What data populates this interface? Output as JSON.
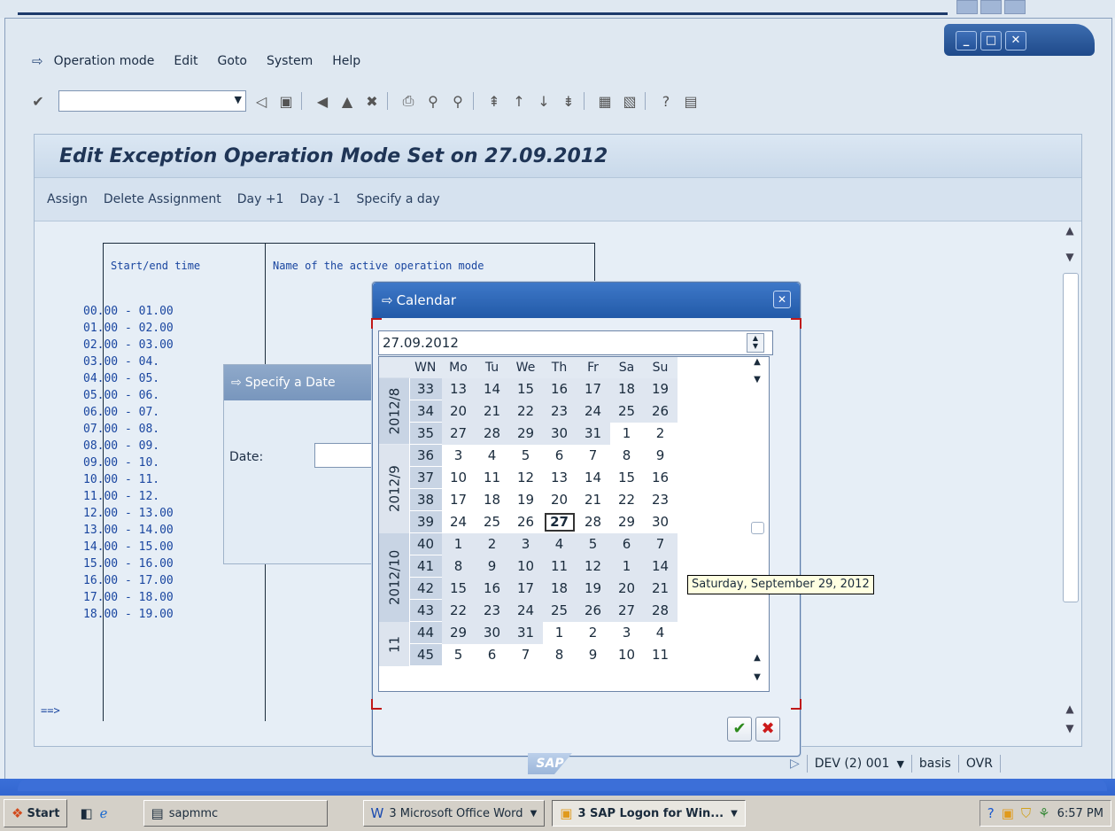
{
  "menu": {
    "items": [
      "Operation mode",
      "Edit",
      "Goto",
      "System",
      "Help"
    ]
  },
  "toolbar": {
    "command_value": ""
  },
  "page": {
    "title": "Edit Exception Operation Mode Set on 27.09.2012",
    "app_buttons": [
      "Assign",
      "Delete Assignment",
      "Day +1",
      "Day -1",
      "Specify a day"
    ]
  },
  "table": {
    "col1": "Start/end time",
    "col2": "Name of the active operation mode",
    "rows": [
      "00.00 - 01.00",
      "01.00 - 02.00",
      "02.00 - 03.00",
      "03.00 - 04.",
      "04.00 - 05.",
      "05.00 - 06.",
      "06.00 - 07.",
      "07.00 - 08.",
      "08.00 - 09.",
      "09.00 - 10.",
      "10.00 - 11.",
      "11.00 - 12.",
      "12.00 - 13.00",
      "13.00 - 14.00",
      "14.00 - 15.00",
      "15.00 - 16.00",
      "16.00 - 17.00",
      "17.00 - 18.00",
      "18.00 - 19.00"
    ],
    "current_marker": "==>"
  },
  "specify_dialog": {
    "title": "Specify a Date",
    "date_label": "Date:"
  },
  "calendar": {
    "title": "Calendar",
    "date_value": "27.09.2012",
    "headers": [
      "WN",
      "Mo",
      "Tu",
      "We",
      "Th",
      "Fr",
      "Sa",
      "Su"
    ],
    "month_labels": [
      "2012/8",
      "2012/9",
      "2012/10",
      "11"
    ],
    "weeks": [
      {
        "wn": "33",
        "days": [
          "13",
          "14",
          "15",
          "16",
          "17",
          "18",
          "19"
        ]
      },
      {
        "wn": "34",
        "days": [
          "20",
          "21",
          "22",
          "23",
          "24",
          "25",
          "26"
        ]
      },
      {
        "wn": "35",
        "days": [
          "27",
          "28",
          "29",
          "30",
          "31",
          "1",
          "2"
        ]
      },
      {
        "wn": "36",
        "days": [
          "3",
          "4",
          "5",
          "6",
          "7",
          "8",
          "9"
        ]
      },
      {
        "wn": "37",
        "days": [
          "10",
          "11",
          "12",
          "13",
          "14",
          "15",
          "16"
        ]
      },
      {
        "wn": "38",
        "days": [
          "17",
          "18",
          "19",
          "20",
          "21",
          "22",
          "23"
        ]
      },
      {
        "wn": "39",
        "days": [
          "24",
          "25",
          "26",
          "27",
          "28",
          "29",
          "30"
        ]
      },
      {
        "wn": "40",
        "days": [
          "1",
          "2",
          "3",
          "4",
          "5",
          "6",
          "7"
        ]
      },
      {
        "wn": "41",
        "days": [
          "8",
          "9",
          "10",
          "11",
          "12",
          "1",
          "14"
        ]
      },
      {
        "wn": "42",
        "days": [
          "15",
          "16",
          "17",
          "18",
          "19",
          "20",
          "21"
        ]
      },
      {
        "wn": "43",
        "days": [
          "22",
          "23",
          "24",
          "25",
          "26",
          "27",
          "28"
        ]
      },
      {
        "wn": "44",
        "days": [
          "29",
          "30",
          "31",
          "1",
          "2",
          "3",
          "4"
        ]
      },
      {
        "wn": "45",
        "days": [
          "5",
          "6",
          "7",
          "8",
          "9",
          "10",
          "11"
        ]
      }
    ],
    "tooltip": "Saturday, September 29, 2012"
  },
  "status": {
    "system": "DEV (2) 001",
    "user": "basis",
    "mode": "OVR",
    "logo": "SAP"
  },
  "taskbar": {
    "start": "Start",
    "tasks": [
      "sapmmc",
      "3 Microsoft Office Word",
      "3 SAP Logon for Win..."
    ],
    "clock": "6:57 PM"
  }
}
